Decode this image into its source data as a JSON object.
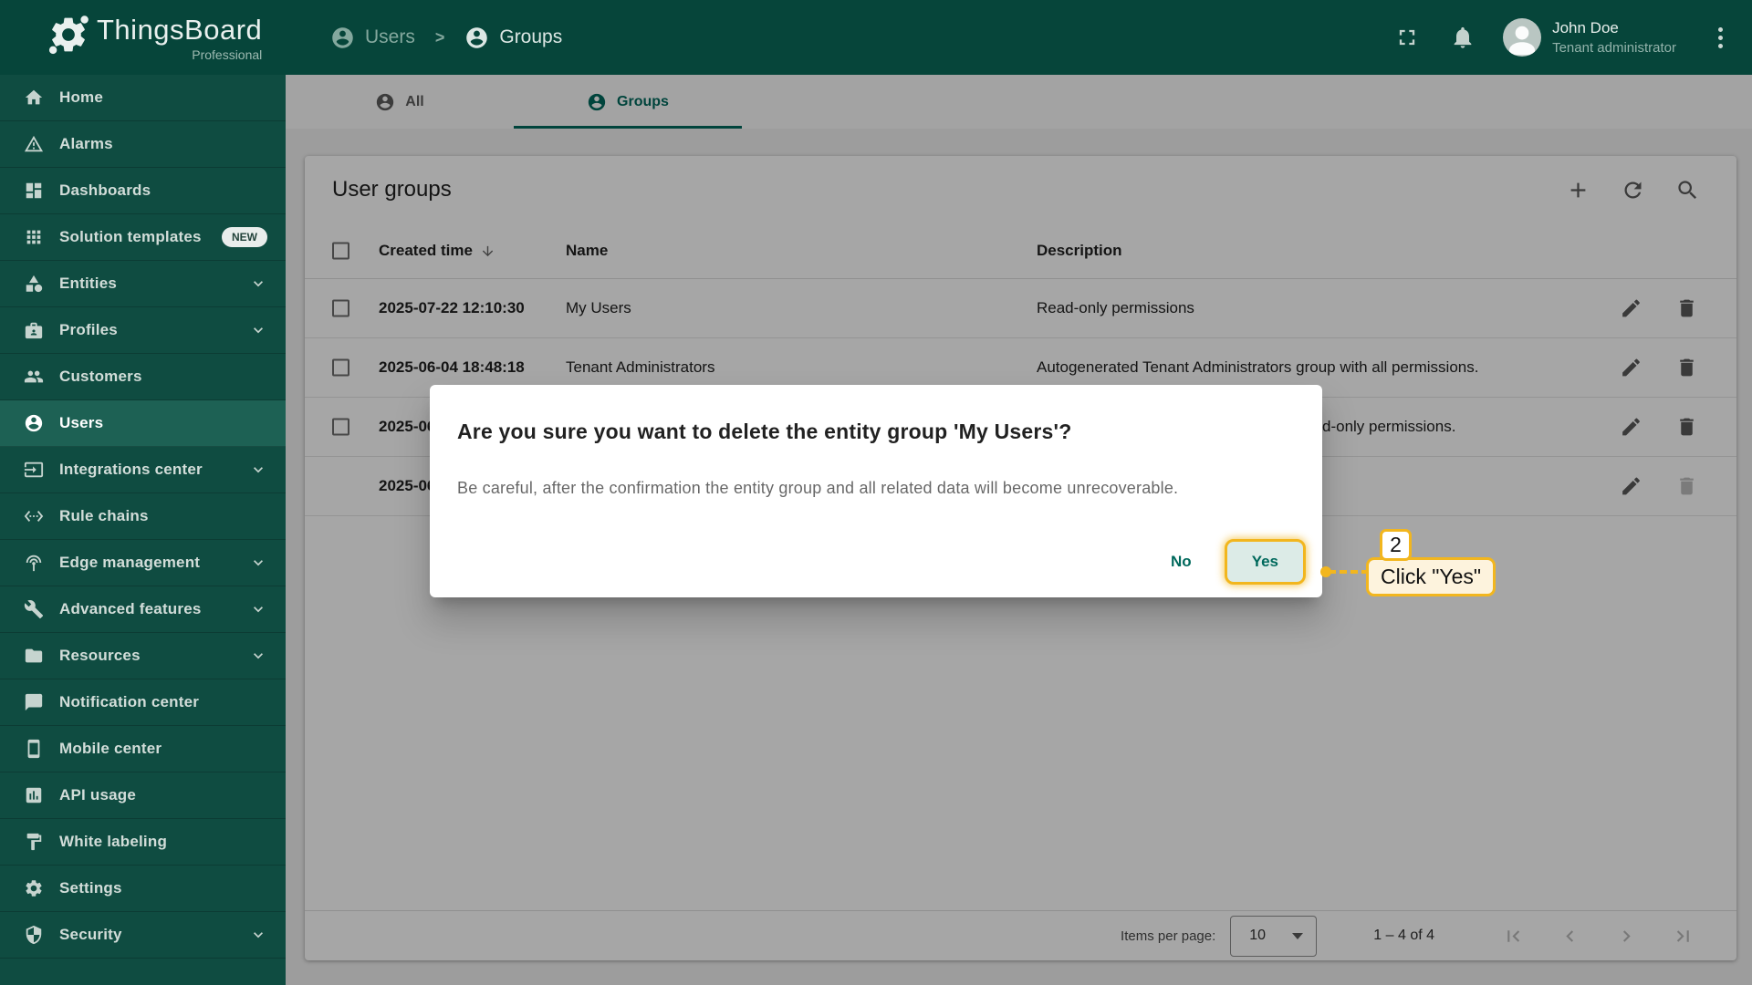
{
  "colors": {
    "primary_teal": "#00695c",
    "header_green": "#06453a",
    "sidebar_green": "#0f4c41",
    "sidebar_active_green": "#1d6154",
    "annotation_yellow": "#f2b61e",
    "backdrop": "rgba(0,0,0,0.35)"
  },
  "brand": {
    "name": "ThingsBoard",
    "edition": "Professional"
  },
  "breadcrumb": {
    "separator": ">",
    "items": [
      {
        "label": "Users",
        "icon": "person"
      },
      {
        "label": "Groups",
        "icon": "person"
      }
    ]
  },
  "header": {
    "user": {
      "name": "John Doe",
      "role": "Tenant administrator"
    }
  },
  "sidebar": {
    "items": [
      {
        "slug": "home",
        "label": "Home",
        "icon": "home"
      },
      {
        "slug": "alarms",
        "label": "Alarms",
        "icon": "warning"
      },
      {
        "slug": "dashboards",
        "label": "Dashboards",
        "icon": "dashboards"
      },
      {
        "slug": "solution-templates",
        "label": "Solution templates",
        "icon": "grid",
        "badge": "NEW"
      },
      {
        "slug": "entities",
        "label": "Entities",
        "icon": "category",
        "chevron": true
      },
      {
        "slug": "profiles",
        "label": "Profiles",
        "icon": "badge",
        "chevron": true
      },
      {
        "slug": "customers",
        "label": "Customers",
        "icon": "people"
      },
      {
        "slug": "users",
        "label": "Users",
        "icon": "person",
        "active": true
      },
      {
        "slug": "integrations-center",
        "label": "Integrations center",
        "icon": "input",
        "chevron": true
      },
      {
        "slug": "rule-chains",
        "label": "Rule chains",
        "icon": "ethernet"
      },
      {
        "slug": "edge-management",
        "label": "Edge management",
        "icon": "antenna",
        "chevron": true
      },
      {
        "slug": "advanced-features",
        "label": "Advanced features",
        "icon": "wrench",
        "chevron": true
      },
      {
        "slug": "resources",
        "label": "Resources",
        "icon": "folder",
        "chevron": true
      },
      {
        "slug": "notification-center",
        "label": "Notification center",
        "icon": "chat"
      },
      {
        "slug": "mobile-center",
        "label": "Mobile center",
        "icon": "phone"
      },
      {
        "slug": "api-usage",
        "label": "API usage",
        "icon": "chart"
      },
      {
        "slug": "white-labeling",
        "label": "White labeling",
        "icon": "paint"
      },
      {
        "slug": "settings",
        "label": "Settings",
        "icon": "gear"
      },
      {
        "slug": "security",
        "label": "Security",
        "icon": "shield",
        "chevron": true
      }
    ]
  },
  "tabs": [
    {
      "label": "All",
      "active": false
    },
    {
      "label": "Groups",
      "active": true
    }
  ],
  "panel": {
    "title": "User groups"
  },
  "table": {
    "columns": [
      {
        "label": "Created time",
        "sorted": "desc"
      },
      {
        "label": "Name"
      },
      {
        "label": "Description"
      }
    ],
    "rows": [
      {
        "created_time": "2025-07-22 12:10:30",
        "name": "My Users",
        "description": "Read-only permissions",
        "has_checkbox": true,
        "delete_enabled": true,
        "description_occluded": false
      },
      {
        "created_time": "2025-06-04 18:48:18",
        "name": "Tenant Administrators",
        "description": "Autogenerated Tenant Administrators group with all permissions.",
        "has_checkbox": true,
        "delete_enabled": true,
        "description_occluded": false
      },
      {
        "created_time": "2025-06",
        "name": "",
        "description": "d-only permissions.",
        "has_checkbox": true,
        "delete_enabled": true,
        "description_occluded": true
      },
      {
        "created_time": "2025-06",
        "name": "",
        "description": "",
        "has_checkbox": false,
        "delete_enabled": false,
        "description_occluded": false
      }
    ]
  },
  "pagination": {
    "items_per_page_label": "Items per page:",
    "items_per_page_value": "10",
    "range_label": "1 – 4 of 4"
  },
  "dialog": {
    "title": "Are you sure you want to delete the entity group 'My Users'?",
    "message": "Be careful, after the confirmation the entity group and all related data will become unrecoverable.",
    "buttons": {
      "no": "No",
      "yes": "Yes"
    }
  },
  "annotation": {
    "step_number": "2",
    "label": "Click \"Yes\""
  }
}
